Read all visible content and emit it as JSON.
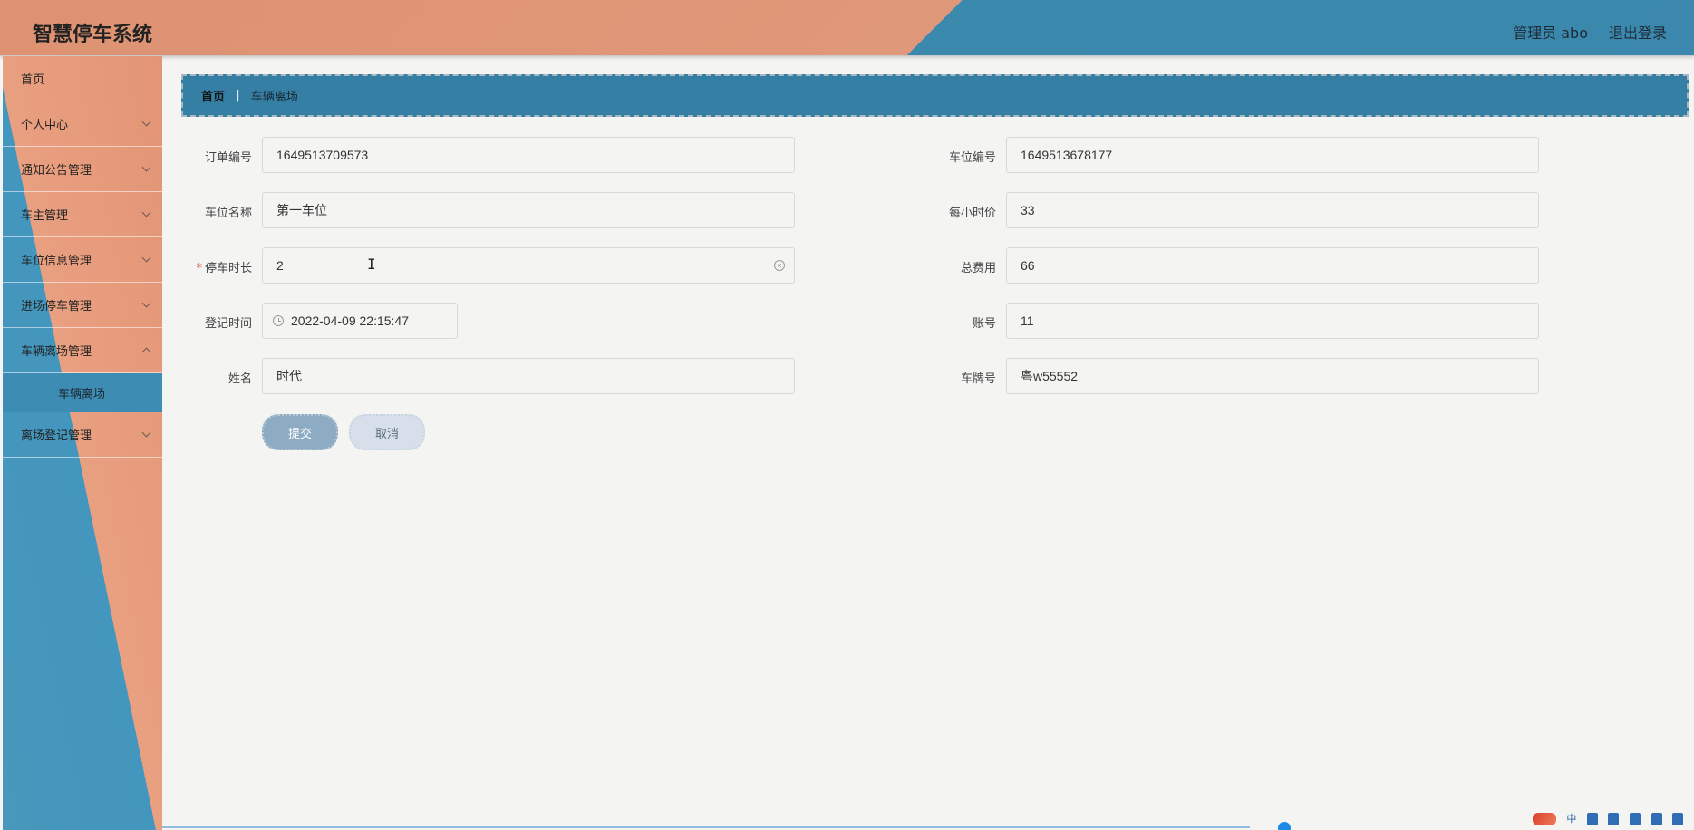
{
  "app": {
    "title": "智慧停车系统",
    "user": "管理员 abo",
    "logout": "退出登录"
  },
  "sidebar": {
    "items": [
      {
        "label": "首页"
      },
      {
        "label": "个人中心"
      },
      {
        "label": "通知公告管理"
      },
      {
        "label": "车主管理"
      },
      {
        "label": "车位信息管理"
      },
      {
        "label": "进场停车管理"
      },
      {
        "label": "车辆离场管理"
      },
      {
        "label": "离场登记管理"
      }
    ],
    "subitem": "车辆离场"
  },
  "breadcrumb": {
    "home": "首页",
    "sep": "|",
    "current": "车辆离场"
  },
  "form": {
    "order_no": {
      "label": "订单编号",
      "value": "1649513709573"
    },
    "space_no": {
      "label": "车位编号",
      "value": "1649513678177"
    },
    "space_name": {
      "label": "车位名称",
      "value": "第一车位"
    },
    "hourly_price": {
      "label": "每小时价",
      "value": "33"
    },
    "duration": {
      "label": "停车时长",
      "value": "2",
      "required_mark": "*"
    },
    "total_fee": {
      "label": "总费用",
      "value": "66"
    },
    "reg_time": {
      "label": "登记时间",
      "value": "2022-04-09 22:15:47"
    },
    "account": {
      "label": "账号",
      "value": "11"
    },
    "name": {
      "label": "姓名",
      "value": "时代"
    },
    "plate": {
      "label": "车牌号",
      "value": "粤w55552"
    }
  },
  "buttons": {
    "submit": "提交",
    "cancel": "取消"
  },
  "tray": {
    "ime": "中"
  }
}
